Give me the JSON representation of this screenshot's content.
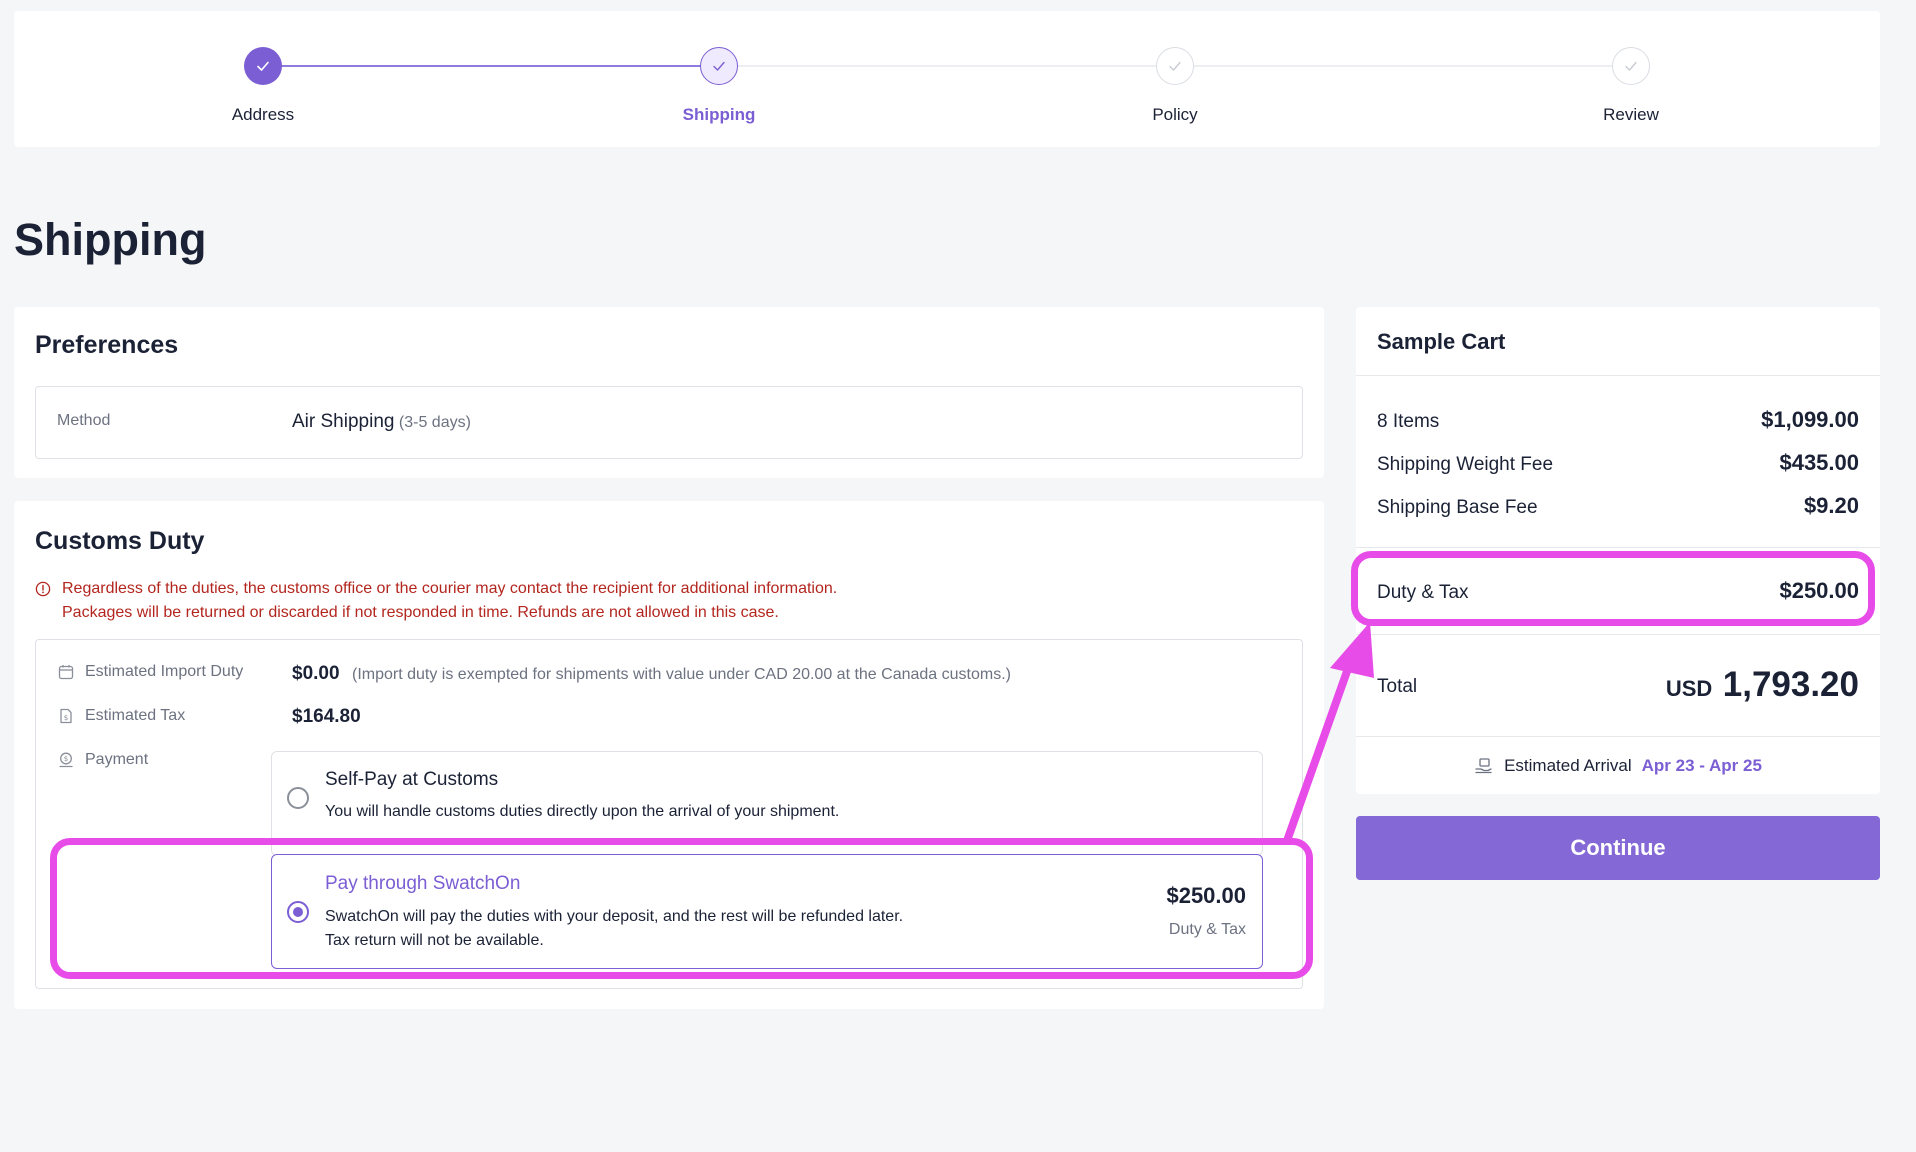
{
  "stepper": {
    "steps": [
      {
        "label": "Address",
        "state": "completed"
      },
      {
        "label": "Shipping",
        "state": "active"
      },
      {
        "label": "Policy",
        "state": "upcoming"
      },
      {
        "label": "Review",
        "state": "upcoming"
      }
    ]
  },
  "page": {
    "title": "Shipping"
  },
  "preferences": {
    "title": "Preferences",
    "method_label": "Method",
    "method_value": "Air Shipping",
    "method_duration": "(3-5 days)"
  },
  "customs": {
    "title": "Customs Duty",
    "warning_line1": "Regardless of the duties, the customs office or the courier may contact the recipient for additional information.",
    "warning_line2": "Packages will be returned or discarded if not responded in time. Refunds are not allowed in this case.",
    "import_duty_label": "Estimated Import Duty",
    "import_duty_value": "$0.00",
    "import_duty_note": "(Import duty is exempted for shipments with value under CAD 20.00 at the Canada customs.)",
    "tax_label": "Estimated Tax",
    "tax_value": "$164.80",
    "payment_label": "Payment",
    "options": [
      {
        "title": "Self-Pay at Customs",
        "desc_line1": "You will handle customs duties directly upon the arrival of your shipment.",
        "selected": false
      },
      {
        "title": "Pay through SwatchOn",
        "desc_line1": "SwatchOn will pay the duties with your deposit, and the rest will be refunded later.",
        "desc_line2": "Tax return will not be available.",
        "amount": "$250.00",
        "amount_label": "Duty & Tax",
        "selected": true
      }
    ]
  },
  "cart": {
    "title": "Sample Cart",
    "rows": [
      {
        "label": "8 Items",
        "value": "$1,099.00"
      },
      {
        "label": "Shipping Weight Fee",
        "value": "$435.00"
      },
      {
        "label": "Shipping Base Fee",
        "value": "$9.20"
      }
    ],
    "duty_tax": {
      "label": "Duty & Tax",
      "value": "$250.00"
    },
    "total": {
      "label": "Total",
      "currency": "USD",
      "amount": "1,793.20"
    },
    "arrival": {
      "label": "Estimated Arrival",
      "dates": "Apr 23 - Apr 25"
    }
  },
  "actions": {
    "continue_label": "Continue"
  },
  "colors": {
    "accent": "#7b5ed3",
    "button": "#8468d6",
    "warning": "#b3261e",
    "annotation": "#e84ce8"
  }
}
